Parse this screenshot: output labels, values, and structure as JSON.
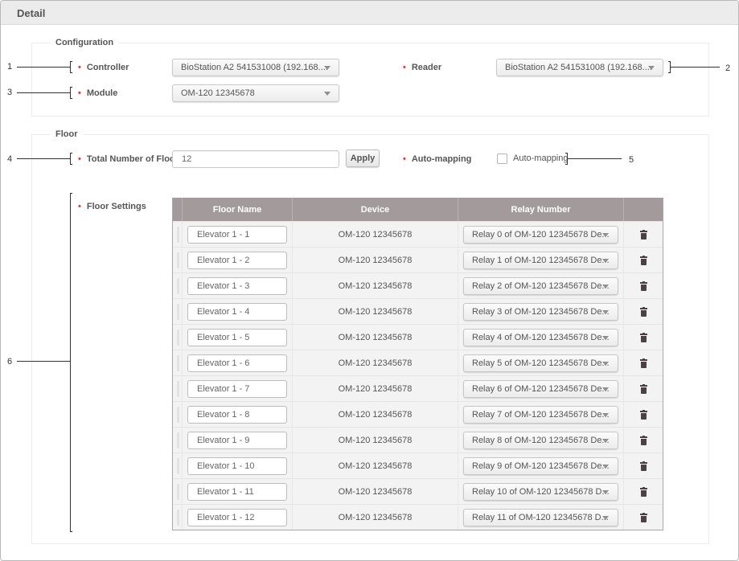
{
  "panel": {
    "title": "Detail"
  },
  "configuration": {
    "legend": "Configuration",
    "controller": {
      "label": "Controller",
      "value": "BioStation A2 541531008 (192.168...."
    },
    "reader": {
      "label": "Reader",
      "value": "BioStation A2 541531008 (192.168...."
    },
    "module": {
      "label": "Module",
      "value": "OM-120 12345678"
    }
  },
  "floor": {
    "legend": "Floor",
    "total_floors": {
      "label": "Total Number of Floors",
      "value": "12",
      "apply_label": "Apply"
    },
    "auto_mapping": {
      "label": "Auto-mapping",
      "checkbox_label": "Auto-mapping",
      "checked": false
    },
    "floor_settings": {
      "label": "Floor Settings",
      "columns": [
        "Floor Name",
        "Device",
        "Relay Number"
      ],
      "rows": [
        {
          "floor_name": "Elevator 1 - 1",
          "device": "OM-120 12345678",
          "relay": "Relay 0 of OM-120 12345678 De..."
        },
        {
          "floor_name": "Elevator 1 - 2",
          "device": "OM-120 12345678",
          "relay": "Relay 1 of OM-120 12345678 De..."
        },
        {
          "floor_name": "Elevator 1 - 3",
          "device": "OM-120 12345678",
          "relay": "Relay 2 of OM-120 12345678 De..."
        },
        {
          "floor_name": "Elevator 1 - 4",
          "device": "OM-120 12345678",
          "relay": "Relay 3 of OM-120 12345678 De..."
        },
        {
          "floor_name": "Elevator 1 - 5",
          "device": "OM-120 12345678",
          "relay": "Relay 4 of OM-120 12345678 De..."
        },
        {
          "floor_name": "Elevator 1 - 6",
          "device": "OM-120 12345678",
          "relay": "Relay 5 of OM-120 12345678 De..."
        },
        {
          "floor_name": "Elevator 1 - 7",
          "device": "OM-120 12345678",
          "relay": "Relay 6 of OM-120 12345678 De..."
        },
        {
          "floor_name": "Elevator 1 - 8",
          "device": "OM-120 12345678",
          "relay": "Relay 7 of OM-120 12345678 De..."
        },
        {
          "floor_name": "Elevator 1 - 9",
          "device": "OM-120 12345678",
          "relay": "Relay 8 of OM-120 12345678 De..."
        },
        {
          "floor_name": "Elevator 1 - 10",
          "device": "OM-120 12345678",
          "relay": "Relay 9 of OM-120 12345678 De..."
        },
        {
          "floor_name": "Elevator 1 - 11",
          "device": "OM-120 12345678",
          "relay": "Relay 10 of OM-120 12345678 D..."
        },
        {
          "floor_name": "Elevator 1 - 12",
          "device": "OM-120 12345678",
          "relay": "Relay 11 of OM-120 12345678 D..."
        }
      ]
    }
  },
  "annotations": [
    "1",
    "2",
    "3",
    "4",
    "5",
    "6"
  ],
  "icons": {
    "row_delete": "trash-icon",
    "row_handle": "drag-handle-icon",
    "dropdown": "caret-down-icon"
  },
  "colors": {
    "required": "#e0403a",
    "table_header": "#a39b9b",
    "trash": "#4a4242"
  }
}
